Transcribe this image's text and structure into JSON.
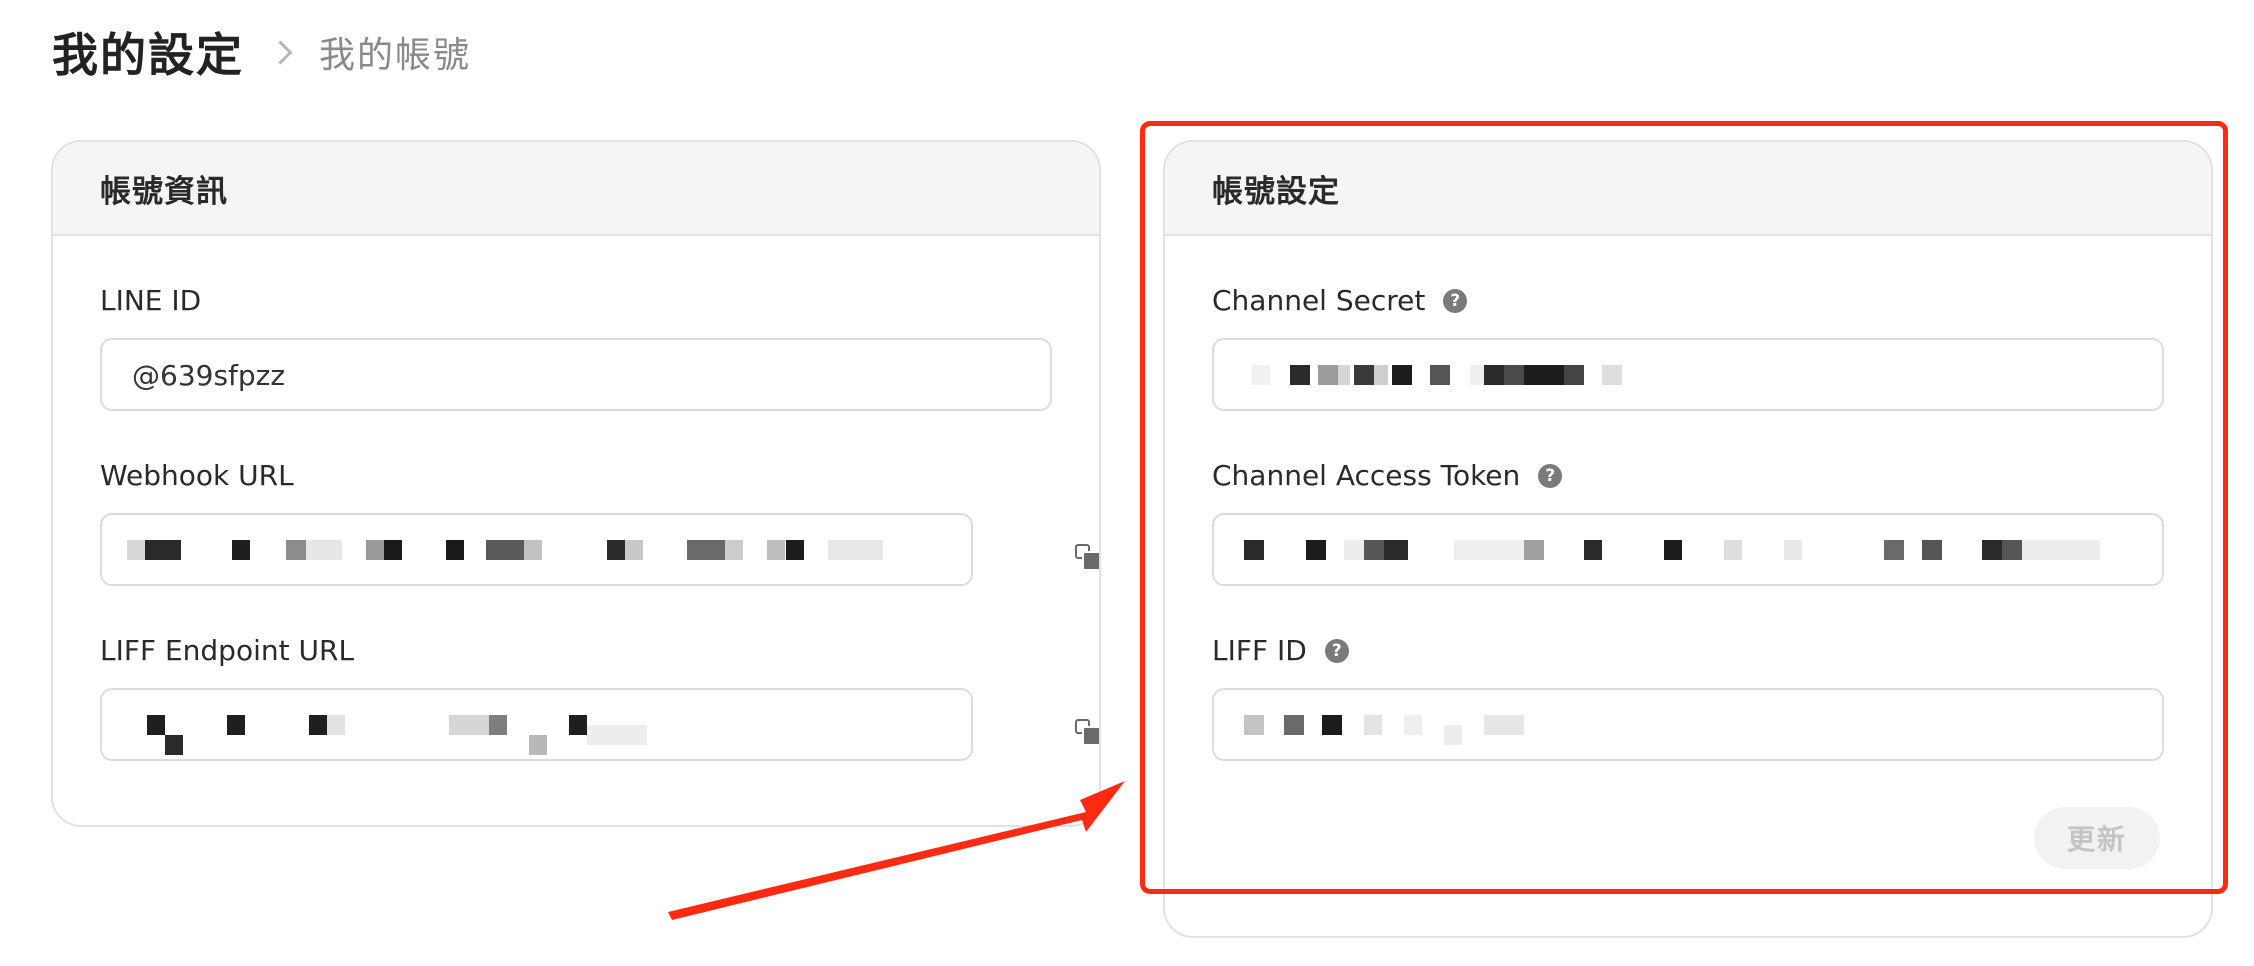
{
  "breadcrumb": {
    "root": "我的設定",
    "current": "我的帳號"
  },
  "account_info": {
    "title": "帳號資訊",
    "line_id_label": "LINE ID",
    "line_id_value": "@639sfpzz",
    "webhook_label": "Webhook URL",
    "liff_endpoint_label": "LIFF Endpoint URL"
  },
  "account_settings": {
    "title": "帳號設定",
    "channel_secret_label": "Channel Secret",
    "channel_access_token_label": "Channel Access Token",
    "liff_id_label": "LIFF ID",
    "update_button": "更新"
  },
  "icons": {
    "help": "question-circle-icon",
    "copy": "copy-icon",
    "separator": "chevron-right-icon"
  },
  "colors": {
    "annotation": "#ff2a12",
    "header_bg": "#f5f5f5",
    "border": "#dcdcdc"
  }
}
